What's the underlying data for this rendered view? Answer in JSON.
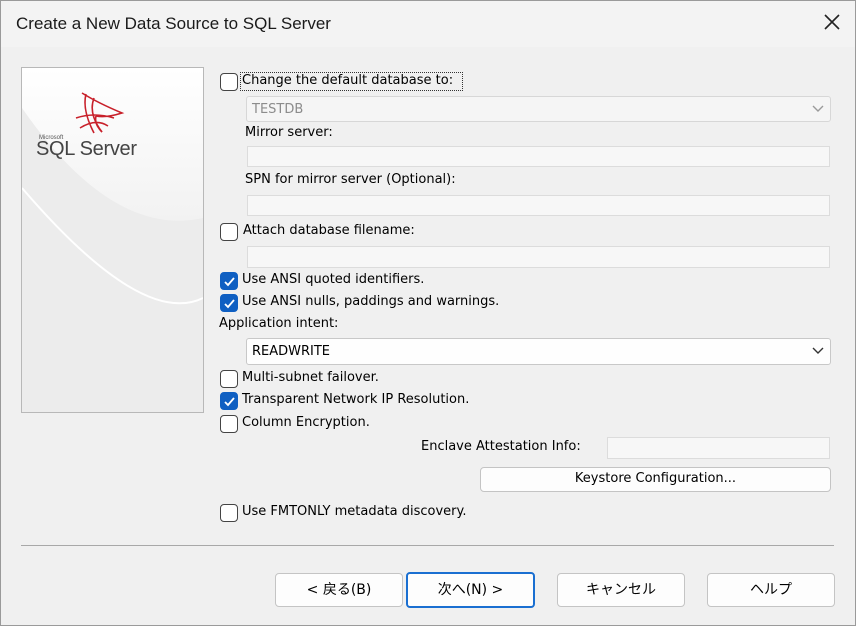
{
  "window": {
    "title": "Create a New Data Source to SQL Server"
  },
  "brand": {
    "microsoft": "Microsoft",
    "product": "SQL Server"
  },
  "options": {
    "change_default_db": {
      "label": "Change the default database to:",
      "checked": false
    },
    "default_db_value": "TESTDB",
    "mirror_server_label": "Mirror server:",
    "mirror_server_value": "",
    "spn_label": "SPN for mirror server (Optional):",
    "spn_value": "",
    "attach_db": {
      "label": "Attach database filename:",
      "checked": false
    },
    "attach_db_value": "",
    "ansi_quoted": {
      "label": "Use ANSI quoted identifiers.",
      "checked": true
    },
    "ansi_nulls": {
      "label": "Use ANSI nulls, paddings and warnings.",
      "checked": true
    },
    "app_intent_label": "Application intent:",
    "app_intent_value": "READWRITE",
    "multi_subnet": {
      "label": "Multi-subnet failover.",
      "checked": false
    },
    "transparent_ip": {
      "label": "Transparent Network IP Resolution.",
      "checked": true
    },
    "column_encryption": {
      "label": "Column Encryption.",
      "checked": false
    },
    "enclave_label": "Enclave Attestation Info:",
    "enclave_value": "",
    "keystore_button": "Keystore Configuration...",
    "fmtonly": {
      "label": "Use FMTONLY metadata discovery.",
      "checked": false
    }
  },
  "footer": {
    "back": "< 戻る(B)",
    "next": "次へ(N) >",
    "cancel": "キャンセル",
    "help": "ヘルプ"
  },
  "colors": {
    "checkbox_checked": "#0f5fc2",
    "primary_border": "#1a6fd1",
    "logo_red": "#c8202a"
  }
}
